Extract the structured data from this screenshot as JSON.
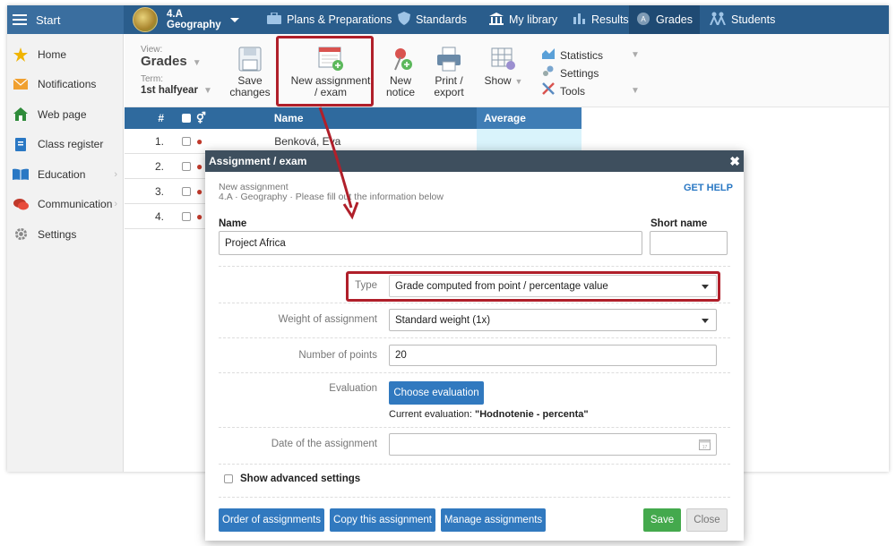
{
  "topbar": {
    "start_label": "Start",
    "class_line1": "4.A",
    "class_line2": "Geography",
    "nav": [
      {
        "label": "Plans & Preparations",
        "icon": "briefcase-icon"
      },
      {
        "label": "Standards",
        "icon": "shield-icon"
      },
      {
        "label": "My library",
        "icon": "library-icon"
      },
      {
        "label": "Results",
        "icon": "bar-chart-icon"
      },
      {
        "label": "Grades",
        "icon": "grades-icon"
      },
      {
        "label": "Students",
        "icon": "students-icon"
      }
    ]
  },
  "sidebar": {
    "items": [
      {
        "label": "Home",
        "icon": "star-icon"
      },
      {
        "label": "Notifications",
        "icon": "envelope-icon"
      },
      {
        "label": "Web page",
        "icon": "house-icon"
      },
      {
        "label": "Class register",
        "icon": "register-icon"
      },
      {
        "label": "Education",
        "icon": "book-icon"
      },
      {
        "label": "Communication",
        "icon": "chat-icon"
      },
      {
        "label": "Settings",
        "icon": "gear-icon"
      }
    ]
  },
  "toolbar": {
    "view_label": "View:",
    "view_value": "Grades",
    "term_label": "Term:",
    "term_value": "1st halfyear",
    "save_line1": "Save",
    "save_line2": "changes",
    "new_assign_line1": "New assignment",
    "new_assign_line2": "/ exam",
    "new_notice_line1": "New",
    "new_notice_line2": "notice",
    "print_line1": "Print /",
    "print_line2": "export",
    "show_label": "Show",
    "menu": [
      "Statistics",
      "Settings",
      "Tools"
    ]
  },
  "table": {
    "headers": {
      "no": "#",
      "name": "Name",
      "average": "Average"
    },
    "rows": [
      {
        "no": "1.",
        "name": "Benková, Eva"
      },
      {
        "no": "2.",
        "name": ""
      },
      {
        "no": "3.",
        "name": ""
      },
      {
        "no": "4.",
        "name": ""
      }
    ]
  },
  "modal": {
    "title": "Assignment / exam",
    "subtitle1": "New assignment",
    "subtitle2": "4.A · Geography · Please fill out the information below",
    "get_help": "GET HELP",
    "name_label": "Name",
    "name_value": "Project Africa",
    "short_name_label": "Short name",
    "short_name_value": "",
    "type_label": "Type",
    "type_value": "Grade computed from point / percentage value",
    "weight_label": "Weight of assignment",
    "weight_value": "Standard weight (1x)",
    "points_label": "Number of points",
    "points_value": "20",
    "evaluation_label": "Evaluation",
    "choose_eval": "Choose evaluation",
    "current_eval_label": "Current evaluation:",
    "current_eval_value": "\"Hodnotenie - percenta\"",
    "date_label": "Date of the assignment",
    "date_value": "",
    "advanced_label": "Show advanced settings",
    "btn_order": "Order of assignments",
    "btn_copy": "Copy this assignment",
    "btn_manage": "Manage assignments",
    "btn_save": "Save",
    "btn_close": "Close"
  },
  "colors": {
    "topbar": "#2a5d8c",
    "highlight": "#b01f2a",
    "primary_button": "#3179bf",
    "save_button": "#44a94d"
  }
}
